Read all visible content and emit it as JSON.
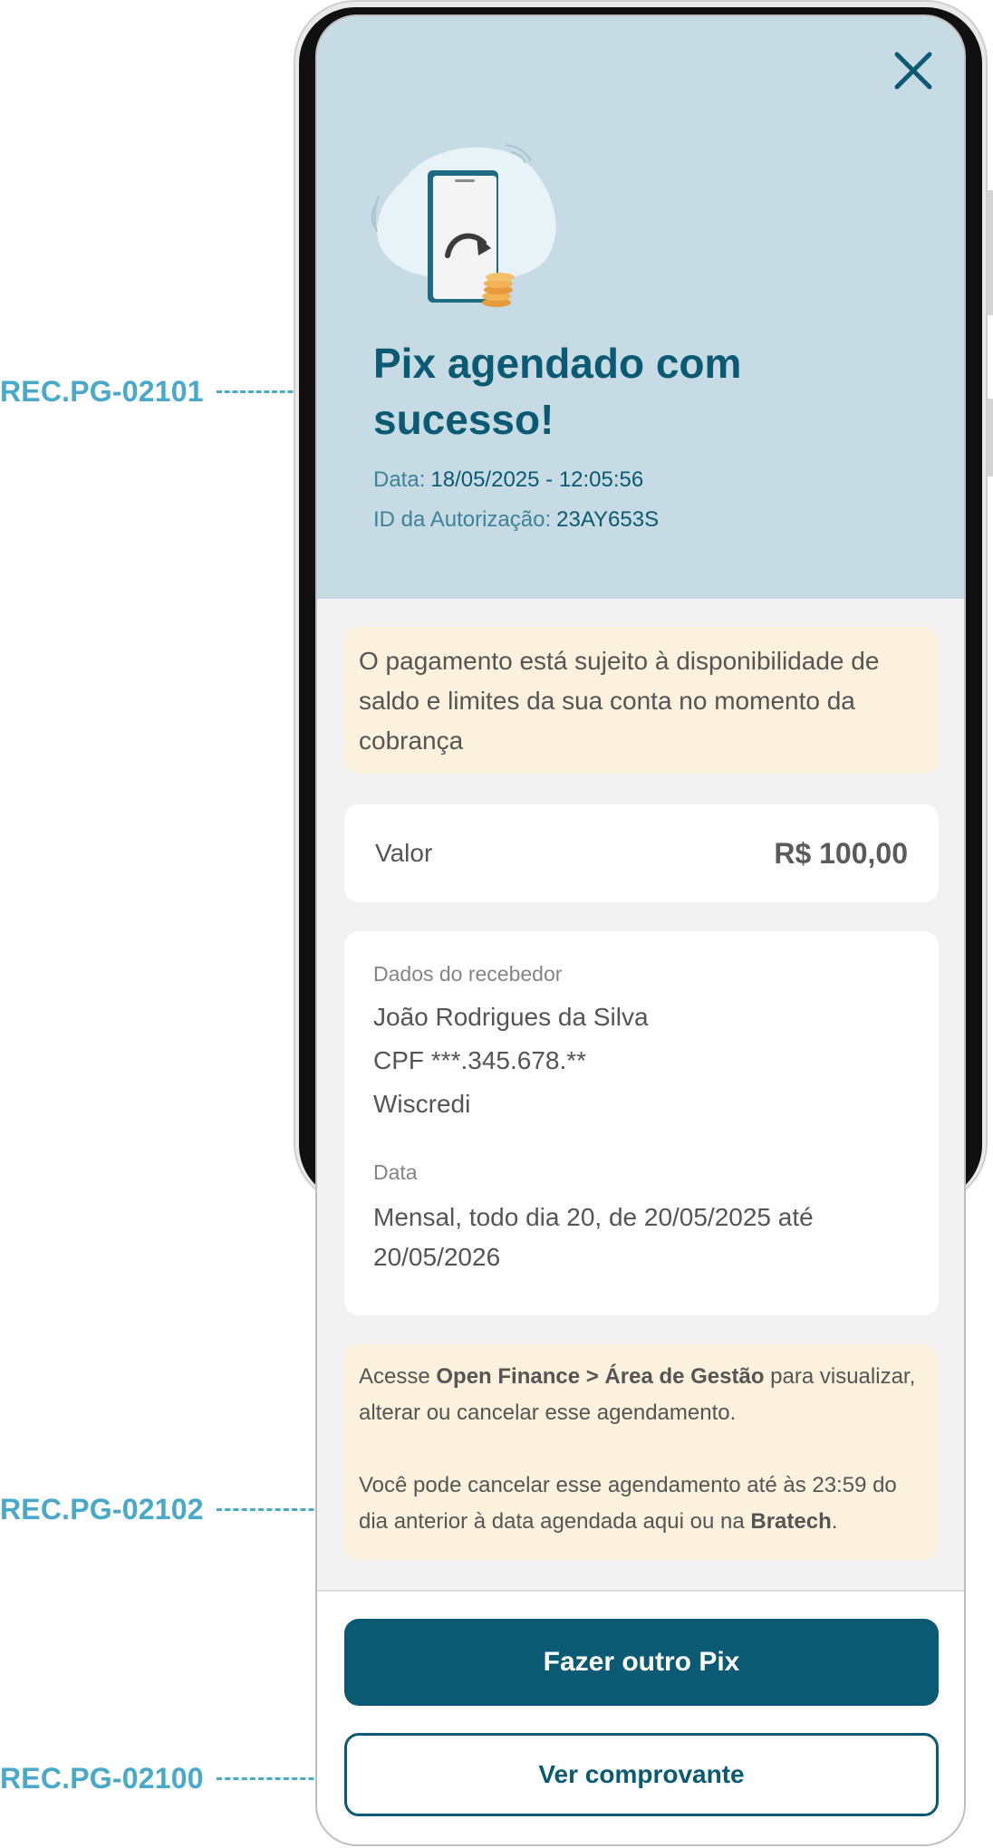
{
  "annotations": [
    {
      "label": "REC.PG-02101"
    },
    {
      "label": "REC.PG-02102"
    },
    {
      "label": "REC.PG-02100"
    }
  ],
  "header": {
    "close_icon": "close-icon",
    "illustration_icon": "phone-with-coins-illustration",
    "title": "Pix agendado com sucesso!",
    "date_label": "Data:",
    "date_value": "18/05/2025 - 12:05:56",
    "auth_label": "ID da Autorização:",
    "auth_value": "23AY653S"
  },
  "notice_top": "O pagamento está sujeito à disponibilidade de saldo e limites da sua conta no momento da cobrança",
  "value_card": {
    "label": "Valor",
    "amount": "R$ 100,00"
  },
  "receiver": {
    "section_label": "Dados do recebedor",
    "name": "João Rodrigues da Silva",
    "document": "CPF ***.345.678.**",
    "institution": "Wiscredi",
    "date_label": "Data",
    "date_value": "Mensal, todo dia 20, de 20/05/2025 até 20/05/2026"
  },
  "notice_bottom": {
    "p1_prefix": "Acesse ",
    "p1_bold": "Open Finance > Área de Gestão",
    "p1_suffix": " para visualizar, alterar ou cancelar esse agendamento.",
    "p2_prefix": "Você pode cancelar esse agendamento até às 23:59 do dia anterior à data agendada aqui ou na ",
    "p2_bold": "Bratech",
    "p2_suffix": "."
  },
  "actions": {
    "primary": "Fazer outro Pix",
    "secondary": "Ver comprovante"
  },
  "colors": {
    "brand": "#0b5a73",
    "header_bg": "#c6dbe3",
    "notice_bg": "#fbf1dc",
    "annotation": "#4aa9c9"
  }
}
